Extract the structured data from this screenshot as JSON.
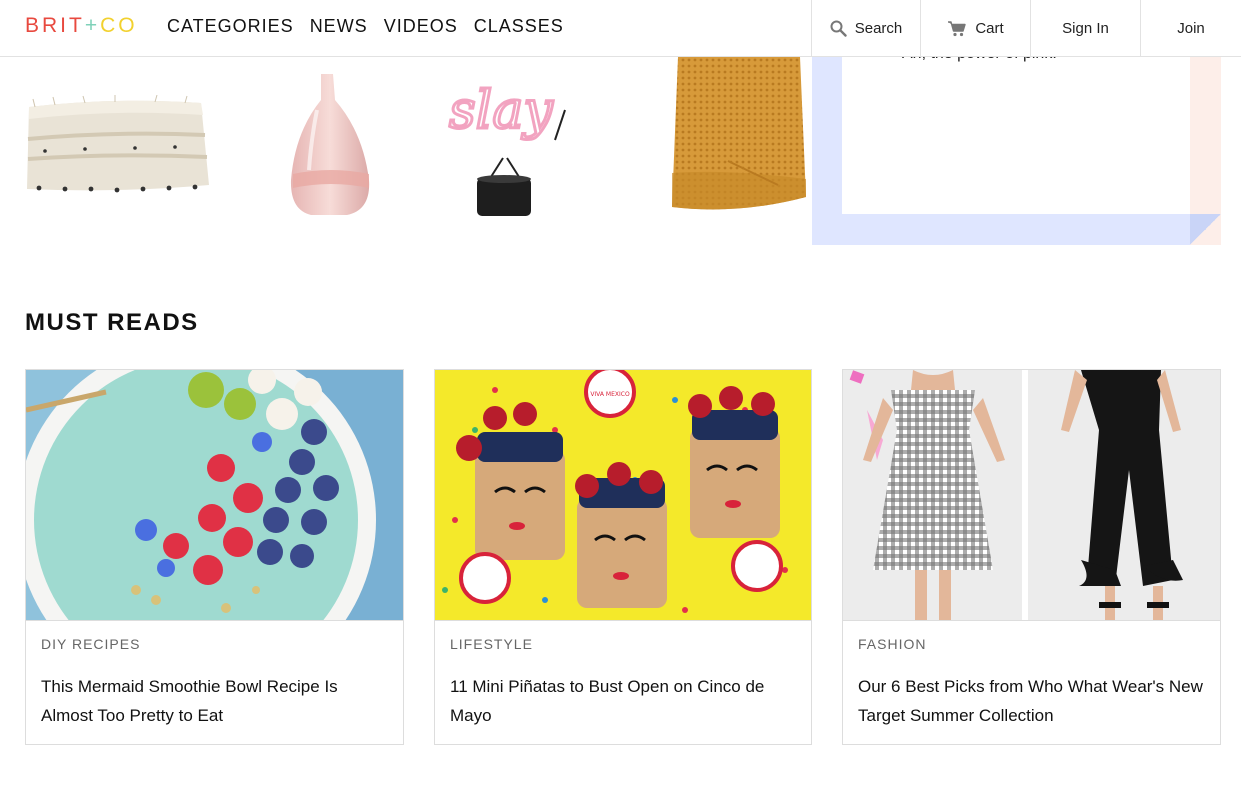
{
  "header": {
    "logo": {
      "brit": "BRIT",
      "plus": "+",
      "co": "CO"
    },
    "nav": [
      "CATEGORIES",
      "NEWS",
      "VIDEOS",
      "CLASSES"
    ],
    "search_label": "Search",
    "cart_label": "Cart",
    "signin_label": "Sign In",
    "join_label": "Join"
  },
  "products": [
    {
      "icon": "rug-image"
    },
    {
      "icon": "pink-vase-image"
    },
    {
      "icon": "slay-neon-sign-image",
      "sign_text": "slay"
    },
    {
      "icon": "mustard-blanket-image"
    }
  ],
  "promo": {
    "text": "Ah, the power of pink."
  },
  "must_reads": {
    "title": "MUST READS",
    "cards": [
      {
        "category": "DIY RECIPES",
        "title": "This Mermaid Smoothie Bowl Recipe Is Almost Too Pretty to Eat"
      },
      {
        "category": "LIFESTYLE",
        "title": "11 Mini Piñatas to Bust Open on Cinco de Mayo",
        "badge_text": "VIVA MEXICO"
      },
      {
        "category": "FASHION",
        "title": "Our 6 Best Picks from Who What Wear's New Target Summer Collection"
      }
    ]
  },
  "colors": {
    "logo_red": "#e8493f",
    "logo_mint": "#7fd1b9",
    "logo_yellow": "#f2d12e",
    "promo_blue": "#dfe6ff",
    "promo_pink": "#fdeee9"
  }
}
